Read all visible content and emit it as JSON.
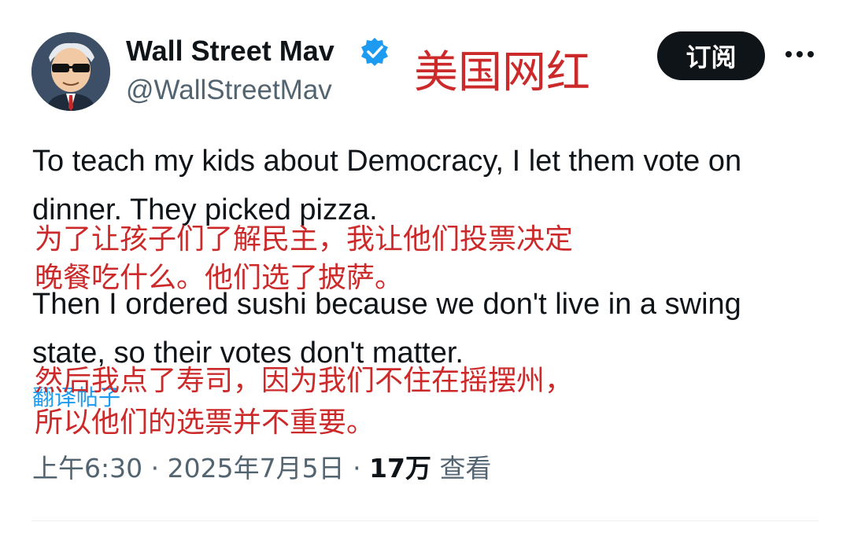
{
  "author": {
    "display_name": "Wall Street Mav",
    "handle": "@WallStreetMav",
    "avatar_icon": "avatar-icon",
    "verified_icon": "verified-badge-icon"
  },
  "annotation_header": "美国网红",
  "actions": {
    "subscribe_label": "订阅",
    "more_icon": "more-horizontal-icon"
  },
  "tweet": {
    "lines": [
      "To teach my kids about Democracy, I let them vote on",
      "dinner. They picked pizza.",
      "Then I ordered sushi because we don't live in a swing",
      "state, so their votes don't matter."
    ]
  },
  "annotations": {
    "para1": [
      "为了让孩子们了解民主，我让他们投票决定",
      "晚餐吃什么。他们选了披萨。"
    ],
    "para2": [
      "然后我点了寿司，因为我们不住在摇摆州，",
      "所以他们的选票并不重要。"
    ]
  },
  "translate_link": "翻译帖子",
  "meta": {
    "time": "上午6:30",
    "separator": "·",
    "date": "2025年7月5日",
    "views_count": "17万",
    "views_label": "查看"
  },
  "colors": {
    "text": "#0f1419",
    "secondary": "#536471",
    "annotation": "#cc2a2a",
    "link": "#1d9bf0",
    "verified": "#1d9bf0"
  }
}
